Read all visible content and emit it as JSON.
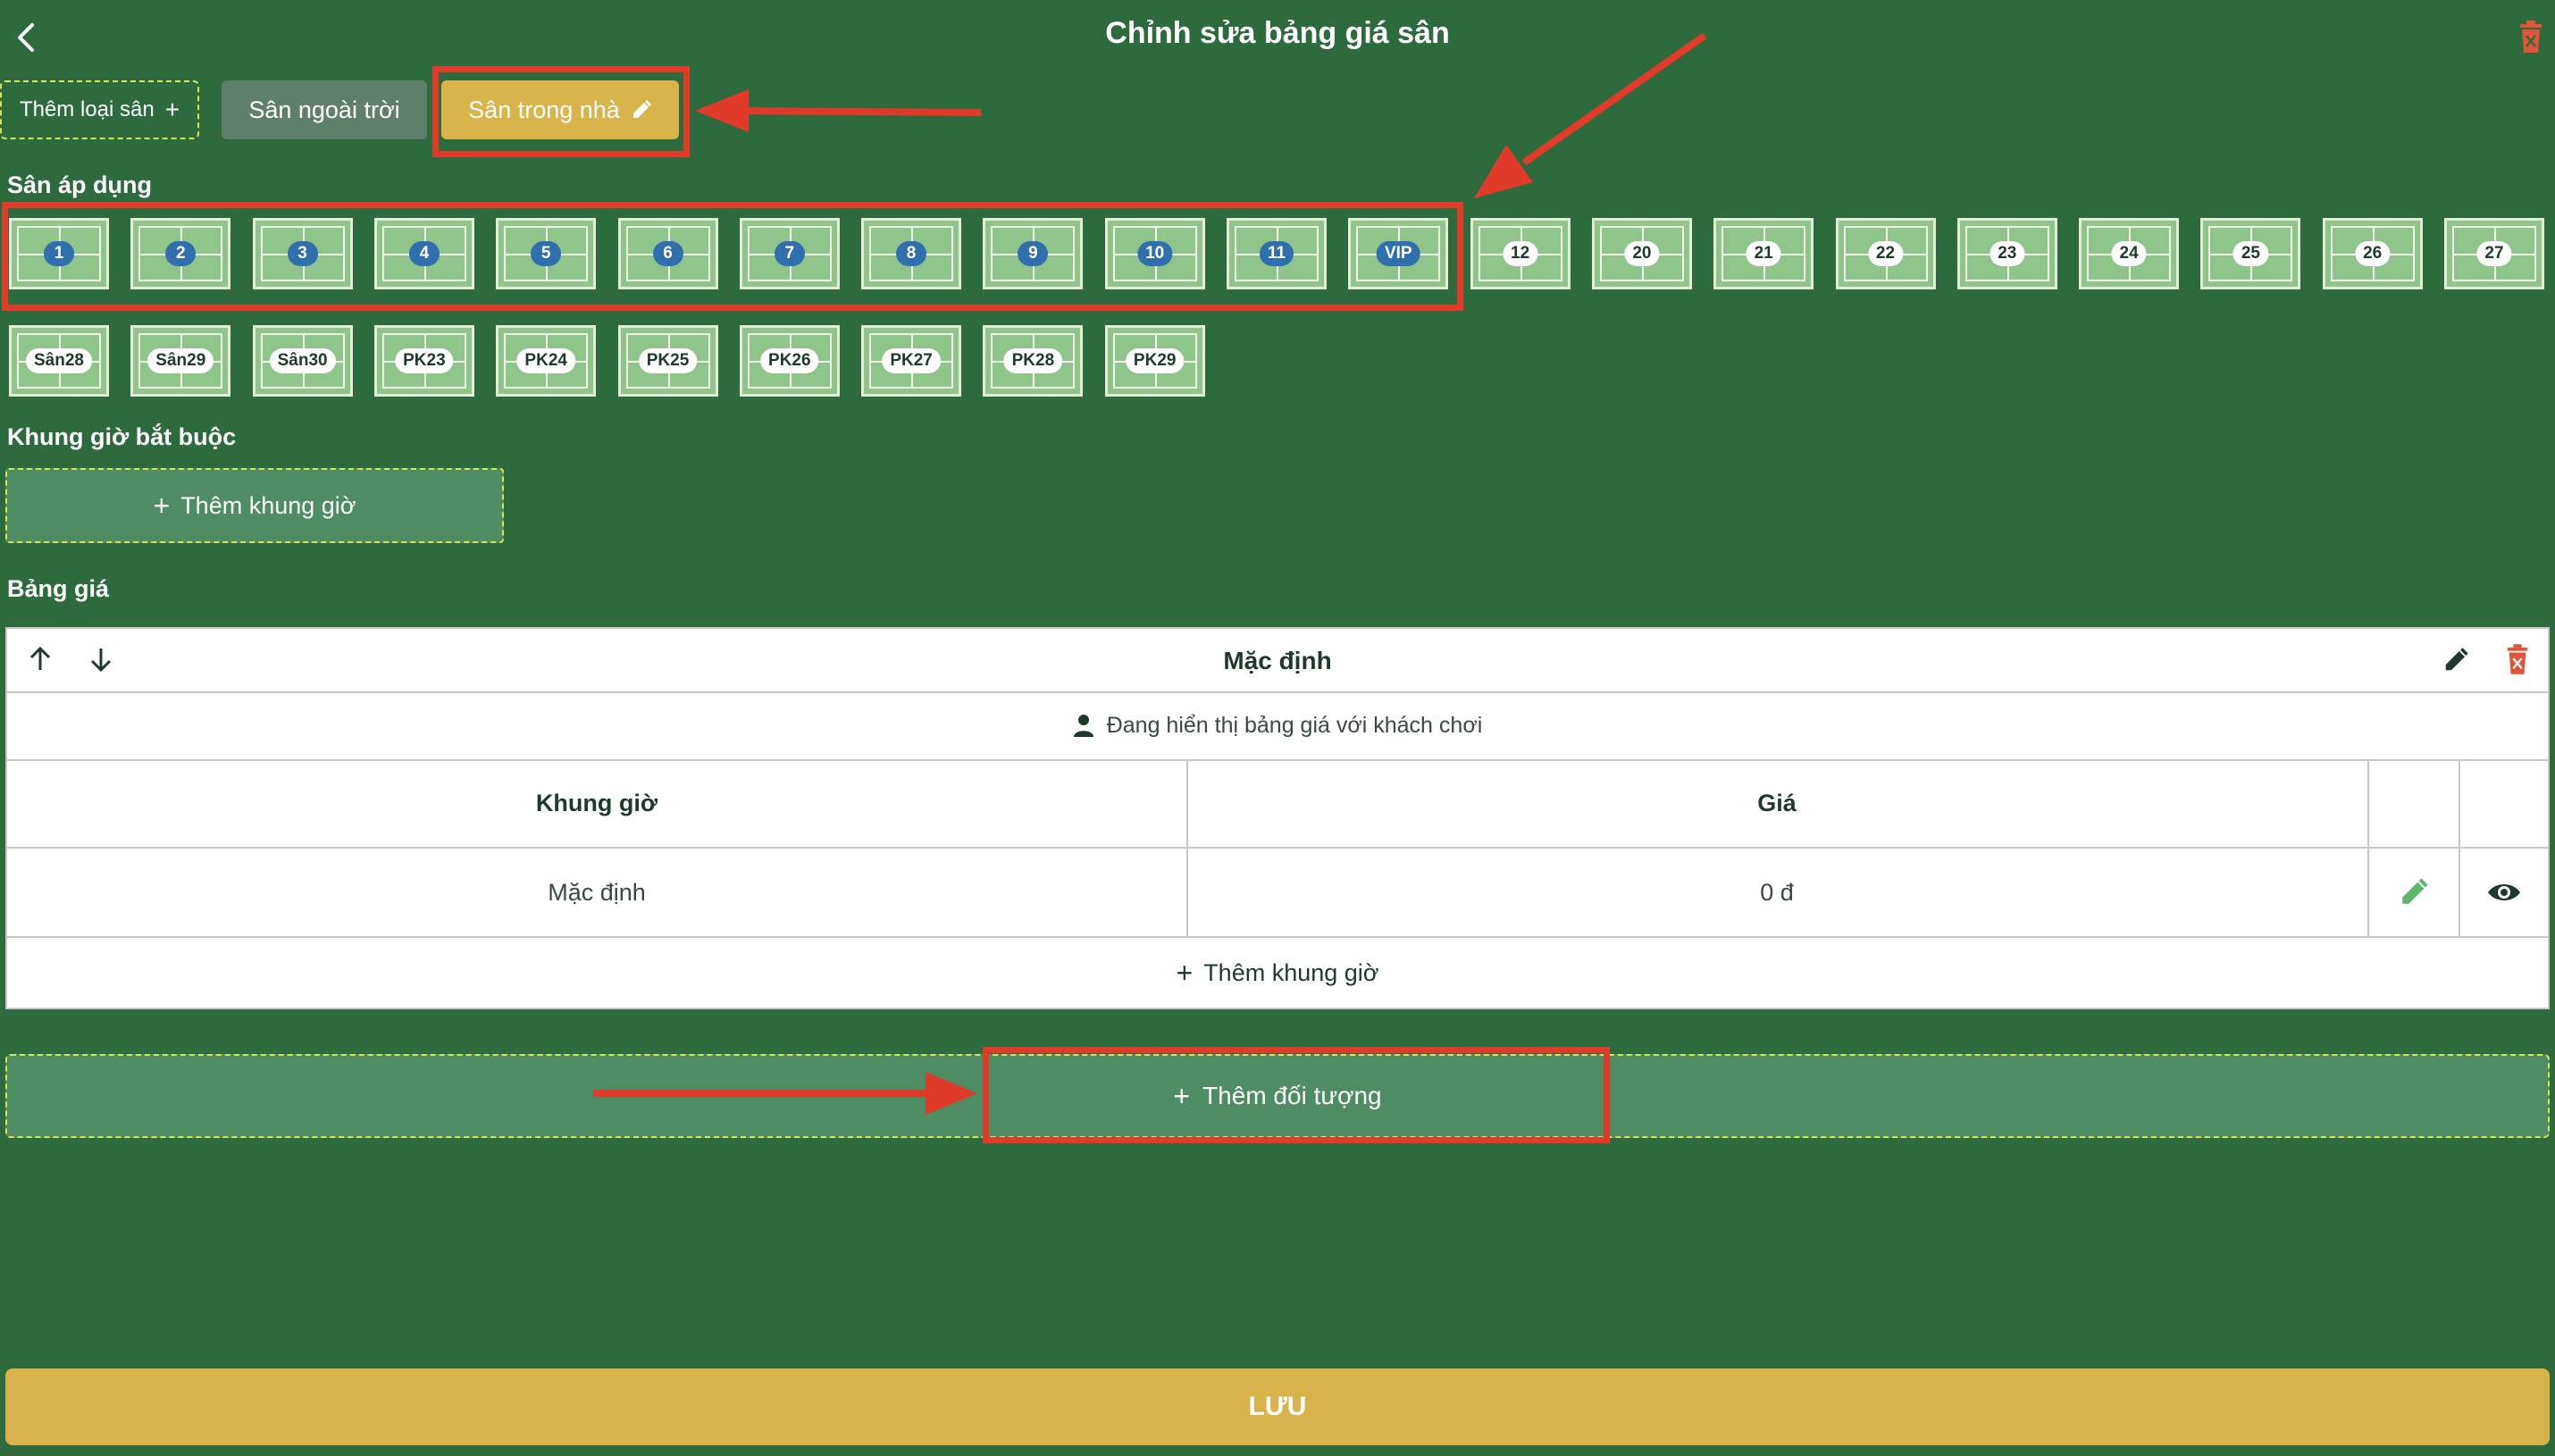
{
  "header": {
    "title": "Chỉnh sửa bảng giá sân"
  },
  "tabs": {
    "add_label": "Thêm loại sân",
    "outdoor_label": "Sân ngoài trời",
    "indoor_label": "Sân trong nhà"
  },
  "courts_section": {
    "label": "Sân áp dụng",
    "row1": [
      {
        "label": "1",
        "selected": true
      },
      {
        "label": "2",
        "selected": true
      },
      {
        "label": "3",
        "selected": true
      },
      {
        "label": "4",
        "selected": true
      },
      {
        "label": "5",
        "selected": true
      },
      {
        "label": "6",
        "selected": true
      },
      {
        "label": "7",
        "selected": true
      },
      {
        "label": "8",
        "selected": true
      },
      {
        "label": "9",
        "selected": true
      },
      {
        "label": "10",
        "selected": true
      },
      {
        "label": "11",
        "selected": true
      },
      {
        "label": "VIP",
        "selected": true
      },
      {
        "label": "12",
        "selected": false
      },
      {
        "label": "20",
        "selected": false
      },
      {
        "label": "21",
        "selected": false
      },
      {
        "label": "22",
        "selected": false
      },
      {
        "label": "23",
        "selected": false
      },
      {
        "label": "24",
        "selected": false
      },
      {
        "label": "25",
        "selected": false
      },
      {
        "label": "26",
        "selected": false
      },
      {
        "label": "27",
        "selected": false
      }
    ],
    "row2": [
      {
        "label": "Sân28",
        "selected": false
      },
      {
        "label": "Sân29",
        "selected": false
      },
      {
        "label": "Sân30",
        "selected": false
      },
      {
        "label": "PK23",
        "selected": false
      },
      {
        "label": "PK24",
        "selected": false
      },
      {
        "label": "PK25",
        "selected": false
      },
      {
        "label": "PK26",
        "selected": false
      },
      {
        "label": "PK27",
        "selected": false
      },
      {
        "label": "PK28",
        "selected": false
      },
      {
        "label": "PK29",
        "selected": false
      }
    ]
  },
  "required_slots": {
    "label": "Khung giờ bắt buộc",
    "add_label": "Thêm khung giờ"
  },
  "price_table": {
    "label": "Bảng giá",
    "title": "Mặc định",
    "visibility_text": "Đang hiển thị bảng giá với khách chơi",
    "col_time": "Khung giờ",
    "col_price": "Giá",
    "row_time": "Mặc định",
    "row_price": "0 đ",
    "add_slot_label": "Thêm khung giờ"
  },
  "add_object_label": "Thêm đối tượng",
  "save_label": "LƯU",
  "colors": {
    "background": "#2e6b3c",
    "accent_gold": "#d9b44a",
    "selected_badge": "#2f6fae",
    "highlight_red": "#e03a2a",
    "delete_orange": "#e0553a"
  }
}
